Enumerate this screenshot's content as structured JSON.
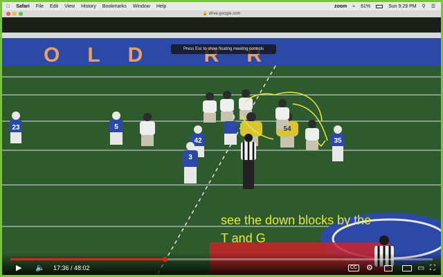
{
  "menubar": {
    "apple_icon": "apple-icon",
    "app_name": "Safari",
    "items": [
      "File",
      "Edit",
      "View",
      "History",
      "Bookmarks",
      "Window",
      "Help"
    ],
    "zoom": "zoom",
    "battery": "61%",
    "clock": "Sun 9:29 PM"
  },
  "browser": {
    "url": "drive.google.com"
  },
  "video": {
    "meeting_banner": "Press Esc to show floating meeting controls",
    "annotation_line1": "see the down blocks by the",
    "annotation_line2": "T and G",
    "jersey_numbers": [
      "23",
      "5",
      "42",
      "3",
      "54",
      "35"
    ],
    "endzone_text": "OLD RR"
  },
  "player": {
    "current_time": "17:36",
    "duration": "48:02",
    "time_display": "17:36 / 48:02",
    "progress_fraction": 0.366,
    "play_icon": "play-icon",
    "volume_icon": "volume-icon",
    "captions_label": "CC",
    "settings_icon": "gear-icon",
    "miniplayer_icon": "miniplayer-icon",
    "theater_icon": "theater-icon",
    "airplay_icon": "airplay-icon",
    "fullscreen_icon": "fullscreen-icon",
    "accent_color": "#e52020"
  },
  "colors": {
    "frame_border": "#7bc142",
    "annotation": "#e8e840",
    "turf": "#2f5a2d"
  }
}
